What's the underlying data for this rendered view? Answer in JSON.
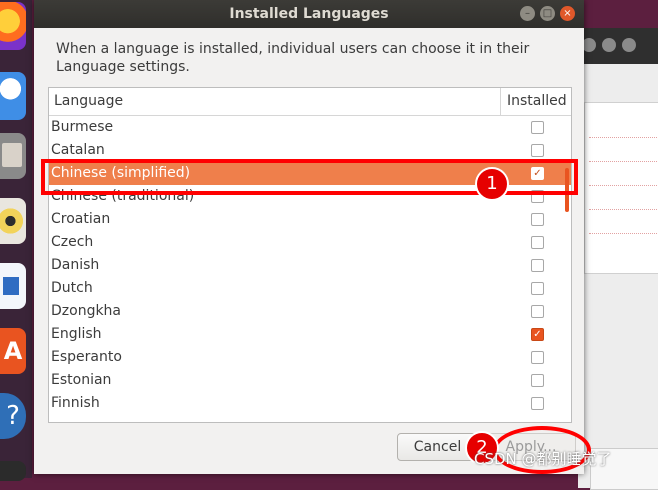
{
  "dialog": {
    "title": "Installed Languages",
    "description": "When a language is installed, individual users can choose it in their Language settings.",
    "columns": {
      "language": "Language",
      "installed": "Installed"
    },
    "languages": [
      {
        "name": "Burmese",
        "installed": false
      },
      {
        "name": "Catalan",
        "installed": false
      },
      {
        "name": "Chinese (simplified)",
        "installed": true,
        "selected": true
      },
      {
        "name": "Chinese (traditional)",
        "installed": false
      },
      {
        "name": "Croatian",
        "installed": false
      },
      {
        "name": "Czech",
        "installed": false
      },
      {
        "name": "Danish",
        "installed": false
      },
      {
        "name": "Dutch",
        "installed": false
      },
      {
        "name": "Dzongkha",
        "installed": false
      },
      {
        "name": "English",
        "installed": true
      },
      {
        "name": "Esperanto",
        "installed": false
      },
      {
        "name": "Estonian",
        "installed": false
      },
      {
        "name": "Finnish",
        "installed": false
      }
    ],
    "buttons": {
      "cancel": "Cancel",
      "apply": "Apply..."
    }
  },
  "annotations": {
    "step1": "1",
    "step2": "2"
  },
  "watermark": "CSDN @都别睡觉了",
  "colors": {
    "accent": "#e95420",
    "selection": "#ef7f4b",
    "annotation": "#ff0000"
  },
  "dock_icons": [
    "firefox-icon",
    "thunderbird-icon",
    "files-icon",
    "rhythmbox-icon",
    "writer-icon",
    "software-center-icon",
    "help-icon",
    "terminal-icon"
  ]
}
